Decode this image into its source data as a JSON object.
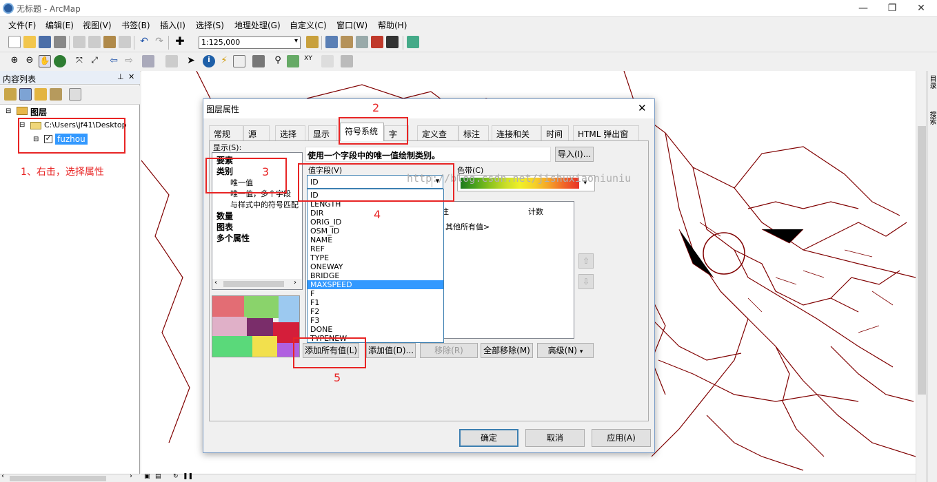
{
  "window": {
    "title": "无标题 - ArcMap"
  },
  "menu": [
    "文件(F)",
    "编辑(E)",
    "视图(V)",
    "书签(B)",
    "插入(I)",
    "选择(S)",
    "地理处理(G)",
    "自定义(C)",
    "窗口(W)",
    "帮助(H)"
  ],
  "toolbar": {
    "scale": "1:125,000"
  },
  "toc": {
    "title": "内容列表",
    "root_label": "图层",
    "path": "C:\\Users\\jf41\\Desktop",
    "layer_name": "fuzhou"
  },
  "annotations": {
    "step1": "1、右击，选择属性",
    "step2": "2",
    "step3": "3",
    "step4": "4",
    "step5": "5"
  },
  "watermark": "http://blog.csdn.net/jishuxiaoniuniu",
  "dialog": {
    "title": "图层属性",
    "tabs": [
      "常规",
      "源",
      "选择",
      "显示",
      "符号系统",
      "字段",
      "定义查询",
      "标注",
      "连接和关联",
      "时间",
      "HTML 弹出窗口"
    ],
    "active_tab": "符号系统",
    "show_label": "显示(S):",
    "show_tree": [
      {
        "label": "要素",
        "bold": true
      },
      {
        "label": "类别",
        "bold": true
      },
      {
        "label": "唯一值",
        "bold": false
      },
      {
        "label": "唯一值，多个字段",
        "bold": false
      },
      {
        "label": "与样式中的符号匹配",
        "bold": false
      },
      {
        "label": "数量",
        "bold": true
      },
      {
        "label": "图表",
        "bold": true
      },
      {
        "label": "多个属性",
        "bold": true
      }
    ],
    "description": "使用一个字段中的唯一值绘制类别。",
    "import_button": "导入(I)...",
    "value_field_label": "值字段(V)",
    "value_field_selected": "ID",
    "color_ramp_label": "色带(C)",
    "dropdown_items": [
      "ID",
      "LENGTH",
      "DIR",
      "ORIG_ID",
      "OSM_ID",
      "NAME",
      "REF",
      "TYPE",
      "ONEWAY",
      "BRIDGE",
      "MAXSPEED",
      "F",
      "F1",
      "F2",
      "F3",
      "DONE",
      "TYPENEW"
    ],
    "dropdown_highlight": "MAXSPEED",
    "grid_headers": {
      "label_col": "注",
      "count_col": "计数"
    },
    "grid_row_other": "其他所有值>",
    "buttons": {
      "add_all": "添加所有值(L)",
      "add": "添加值(D)...",
      "remove": "移除(R)",
      "remove_all": "全部移除(M)",
      "advanced": "高级(N)",
      "ok": "确定",
      "cancel": "取消",
      "apply": "应用(A)"
    },
    "colors": {
      "highlight": "#3399ff",
      "annotation": "#e82424"
    }
  },
  "right_panel": {
    "tab1": "目录",
    "tab2": "搜索"
  }
}
